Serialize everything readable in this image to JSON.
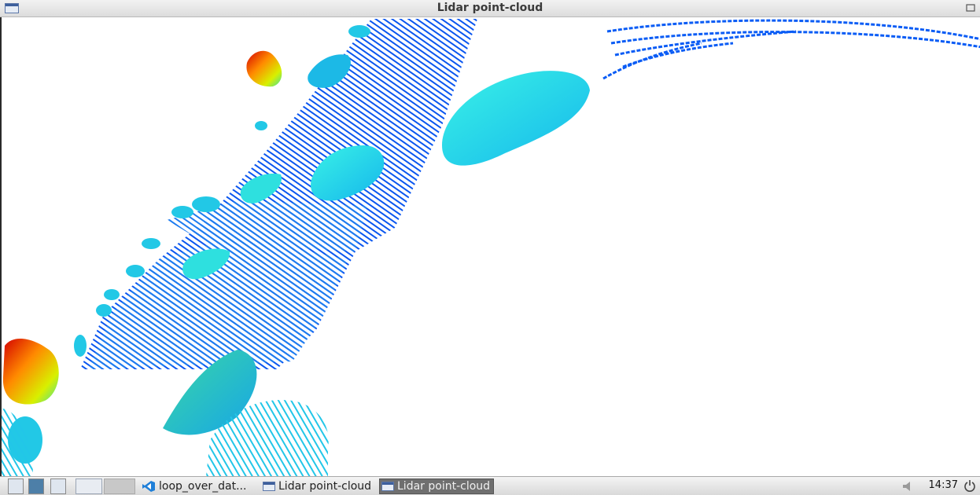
{
  "window": {
    "title": "Lidar point-cloud"
  },
  "taskbar": {
    "tasks": [
      {
        "label": "loop_over_dat...",
        "icon": "vscode-icon"
      },
      {
        "label": "Lidar point-cloud",
        "icon": "window-icon"
      },
      {
        "label": "Lidar point-cloud",
        "icon": "window-icon",
        "active": true
      }
    ],
    "clock": "14:37"
  },
  "colors": {
    "near": "#0040ff",
    "mid": "#00e0e0",
    "far": "#ff2000"
  }
}
